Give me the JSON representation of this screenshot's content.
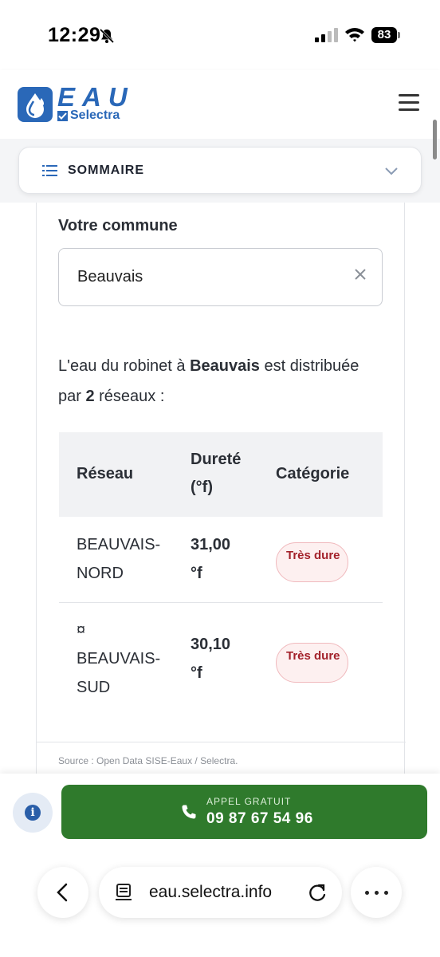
{
  "status_bar": {
    "time": "12:29",
    "battery": "83",
    "icons": [
      "bell-slash-icon",
      "signal-icon",
      "wifi-icon",
      "battery-icon"
    ]
  },
  "header": {
    "logo_main": "EAU",
    "logo_sub": "Selectra",
    "brand_color": "#2a68b8",
    "icons": [
      "water-drop-logo-icon",
      "menu-icon"
    ]
  },
  "sommaire": {
    "label": "SOMMAIRE",
    "icons": [
      "list-icon",
      "chevron-down-icon"
    ]
  },
  "commune": {
    "label": "Votre commune",
    "value": "Beauvais",
    "icons": [
      "clear-icon"
    ]
  },
  "intro": {
    "prefix": "L'eau du robinet à ",
    "city": "Beauvais",
    "middle": " est distribuée par ",
    "count": "2",
    "suffix": " réseaux :"
  },
  "table": {
    "headers": [
      "Réseau",
      "Dureté (°f)",
      "Catégorie"
    ],
    "rows": [
      {
        "reseau": "BEAUVAIS-NORD",
        "durete": "31,00 °f",
        "categorie": "Très dure"
      },
      {
        "reseau": "¤ BEAUVAIS-SUD",
        "durete": "30,10 °f",
        "categorie": "Très dure"
      }
    ],
    "badge_color": "#a3222b"
  },
  "source": "Source : Open Data SISE-Eaux / Selectra.",
  "cta": {
    "small_label": "APPEL GRATUIT",
    "phone": "09 87 67 54 96",
    "color": "#2f7a2c",
    "icons": [
      "info-icon",
      "phone-icon"
    ]
  },
  "browser": {
    "url": "eau.selectra.info",
    "icons": [
      "back-icon",
      "page-icon",
      "reload-icon",
      "more-icon"
    ]
  }
}
